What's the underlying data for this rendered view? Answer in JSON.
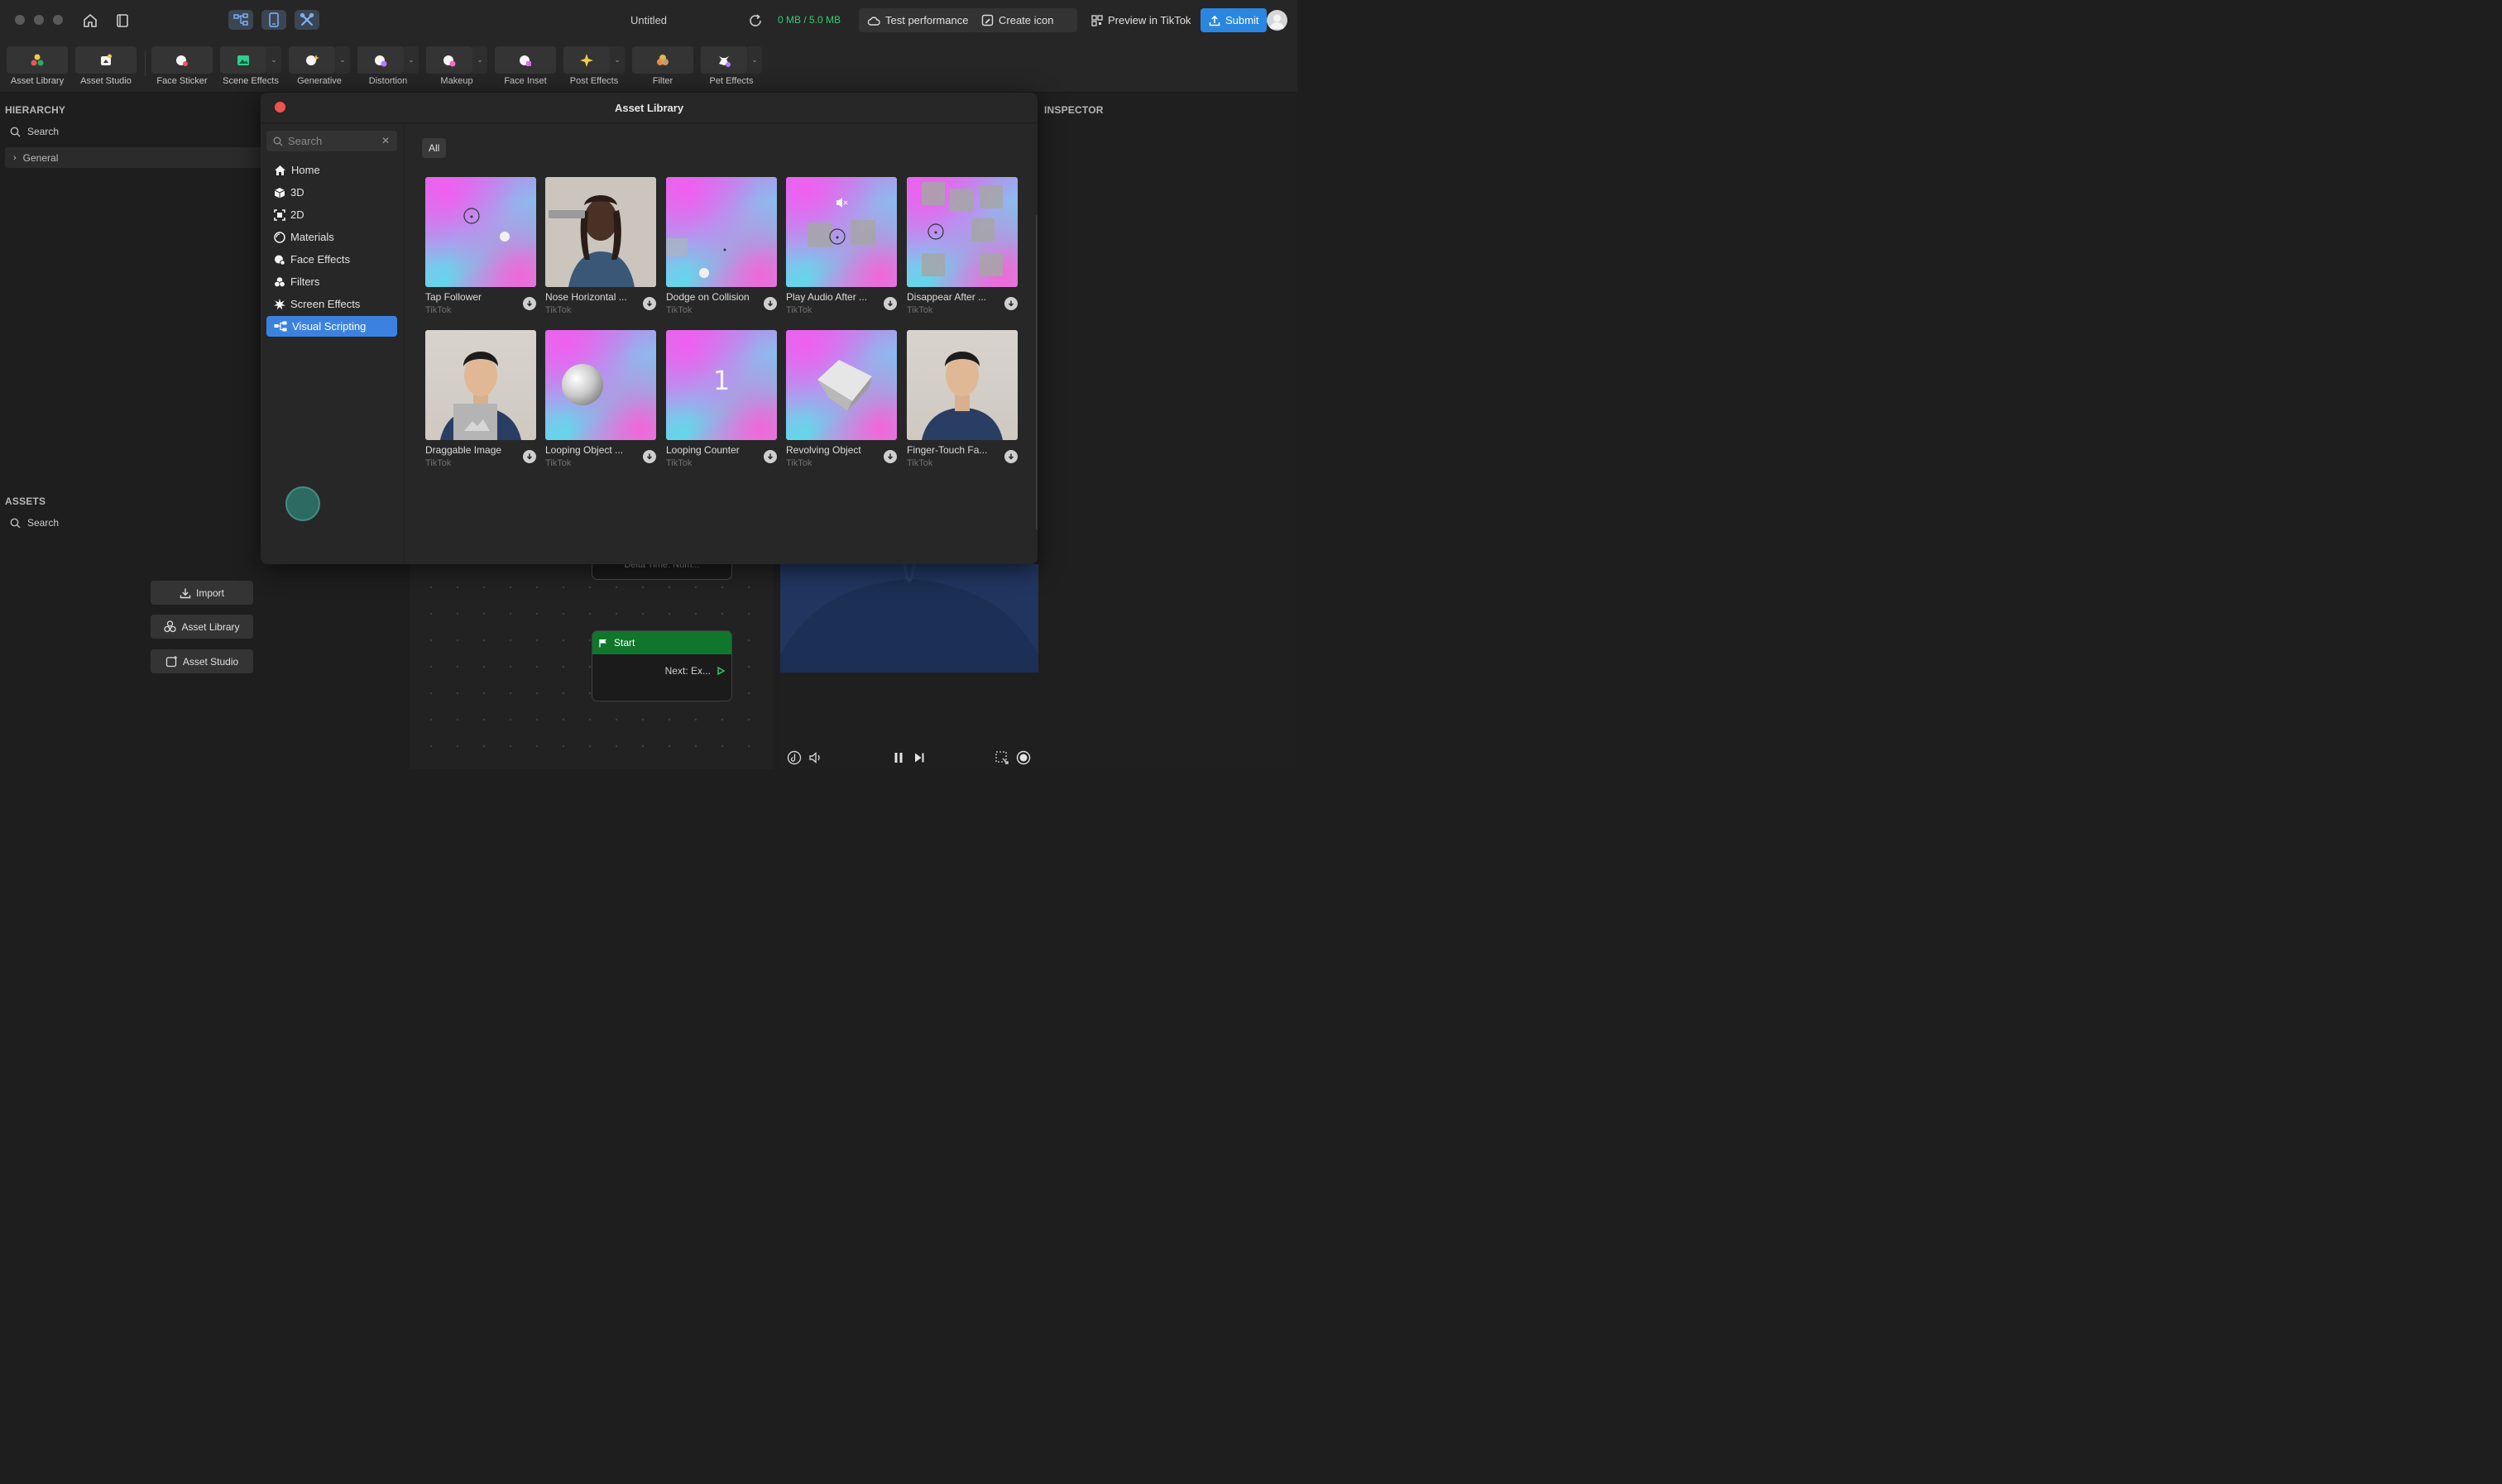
{
  "titlebar": {
    "doc_title": "Untitled",
    "storage": "0 MB / 5.0 MB",
    "test_performance": "Test performance",
    "create_icon": "Create icon",
    "preview_tiktok": "Preview in TikTok",
    "submit": "Submit"
  },
  "toolbar": {
    "items": [
      {
        "label": "Asset Library"
      },
      {
        "label": "Asset Studio"
      },
      {
        "label": "Face Sticker"
      },
      {
        "label": "Scene Effects"
      },
      {
        "label": "Generative"
      },
      {
        "label": "Distortion"
      },
      {
        "label": "Makeup"
      },
      {
        "label": "Face Inset"
      },
      {
        "label": "Post Effects"
      },
      {
        "label": "Filter"
      },
      {
        "label": "Pet Effects"
      }
    ]
  },
  "hierarchy": {
    "title": "HIERARCHY",
    "search_placeholder": "Search",
    "root": "General"
  },
  "assets": {
    "title": "ASSETS",
    "search_placeholder": "Search",
    "import": "Import",
    "asset_library": "Asset Library",
    "asset_studio": "Asset Studio"
  },
  "inspector": {
    "title": "INSPECTOR"
  },
  "modal": {
    "title": "Asset Library",
    "search_placeholder": "Search",
    "filter": "All",
    "categories": [
      {
        "label": "Home"
      },
      {
        "label": "3D"
      },
      {
        "label": "2D"
      },
      {
        "label": "Materials"
      },
      {
        "label": "Face Effects"
      },
      {
        "label": "Filters"
      },
      {
        "label": "Screen Effects"
      },
      {
        "label": "Visual Scripting"
      }
    ],
    "cards": [
      {
        "title": "Tap Follower",
        "author": "TikTok"
      },
      {
        "title": "Nose Horizontal ...",
        "author": "TikTok"
      },
      {
        "title": "Dodge on Collision",
        "author": "TikTok"
      },
      {
        "title": "Play Audio After ...",
        "author": "TikTok"
      },
      {
        "title": "Disappear After ...",
        "author": "TikTok"
      },
      {
        "title": "Draggable Image",
        "author": "TikTok"
      },
      {
        "title": "Looping Object ...",
        "author": "TikTok"
      },
      {
        "title": "Looping Counter",
        "author": "TikTok"
      },
      {
        "title": "Revolving Object",
        "author": "TikTok"
      },
      {
        "title": "Finger-Touch Fa...",
        "author": "TikTok"
      }
    ],
    "counter_digit": "1"
  },
  "graph": {
    "partial_node": "Delta Time: Num...",
    "start_node": {
      "title": "Start",
      "output": "Next: Ex..."
    }
  },
  "colors": {
    "accent": "#3b82e0",
    "submit": "#2a86e0",
    "storage": "#2fce6e",
    "start_node": "#10762b",
    "close": "#f0524f"
  }
}
